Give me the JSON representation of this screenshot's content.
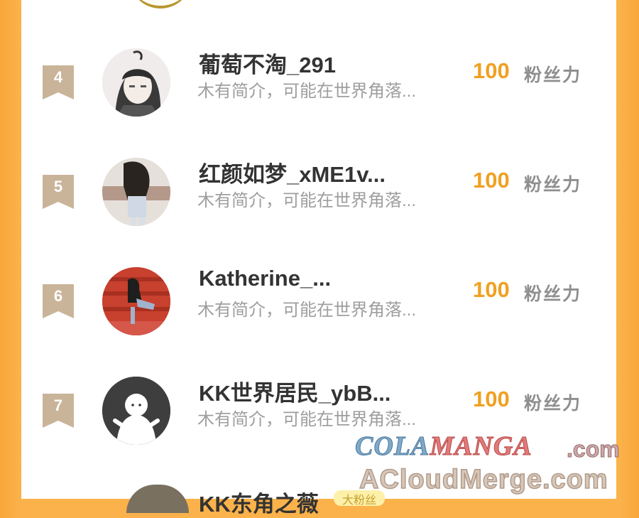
{
  "leaderboard": {
    "entries": [
      {
        "rank": "4",
        "name": "葡萄不淘_291",
        "bio": "木有简介，可能在世界角落...",
        "score": "100",
        "score_unit": "粉丝力",
        "avatar": "anime-boy-avatar"
      },
      {
        "rank": "5",
        "name": "红颜如梦_xME1v...",
        "bio": "木有简介，可能在世界角落...",
        "score": "100",
        "score_unit": "粉丝力",
        "avatar": "photo-avatar"
      },
      {
        "rank": "6",
        "name": "Katherine_...",
        "bio": "木有简介，可能在世界角落...",
        "score": "100",
        "score_unit": "粉丝力",
        "avatar": "photo-avatar"
      },
      {
        "rank": "7",
        "name": "KK世界居民_ybB...",
        "bio": "木有简介，可能在世界角落...",
        "score": "100",
        "score_unit": "粉丝力",
        "avatar": "default-user-avatar"
      }
    ],
    "partial_next": {
      "name": "KK东角之薇",
      "tag": "大粉丝"
    }
  },
  "watermark": {
    "line1_a": "COLA",
    "line1_b": "MANGA",
    "line1_c": ".com",
    "line2": "ACloudMerge.com"
  },
  "colors": {
    "background": "#fbb24a",
    "card": "#ffffff",
    "score": "#f0a020",
    "rank_badge": "#c9b49a"
  }
}
